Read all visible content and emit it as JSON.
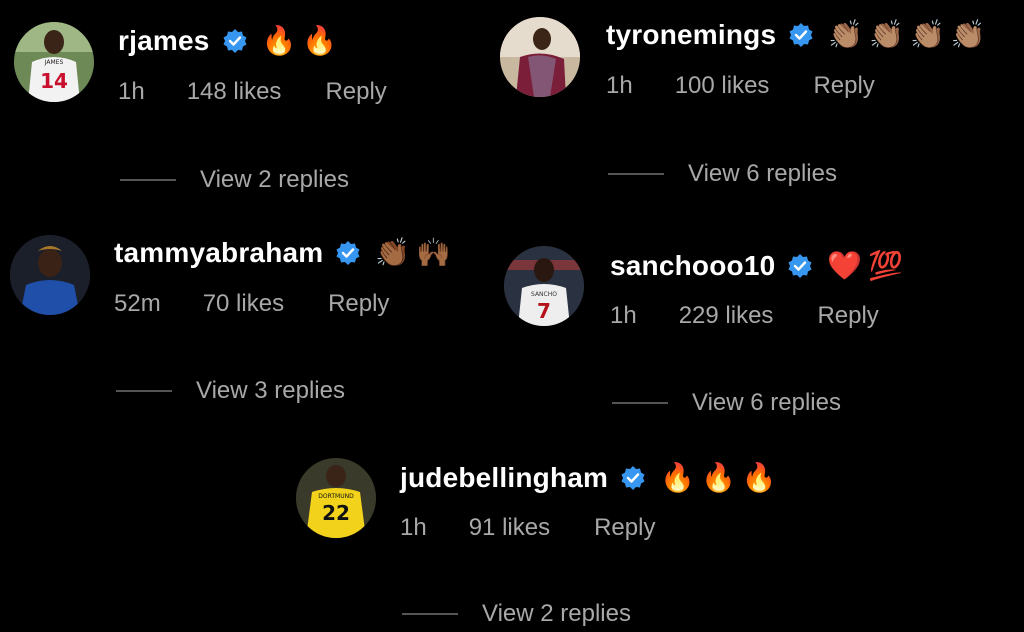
{
  "colors": {
    "background": "#000000",
    "text": "#ffffff",
    "muted": "#a8a8a8",
    "verified": "#3797f0",
    "divider": "#555555"
  },
  "comments": [
    {
      "username": "rjames",
      "emojis": "🔥🔥",
      "time": "1h",
      "likes": "148 likes",
      "reply": "Reply",
      "view_replies": "View 2 replies",
      "avatar_icon": "player-14-avatar-icon"
    },
    {
      "username": "tyronemings",
      "emojis": "👏🏽👏🏽👏🏽👏🏽",
      "time": "1h",
      "likes": "100 likes",
      "reply": "Reply",
      "view_replies": "View 6 replies",
      "avatar_icon": "player-aston-villa-avatar-icon"
    },
    {
      "username": "tammyabraham",
      "emojis": "👏🏾🙌🏾",
      "time": "52m",
      "likes": "70 likes",
      "reply": "Reply",
      "view_replies": "View 3 replies",
      "avatar_icon": "player-blue-kit-avatar-icon"
    },
    {
      "username": "sanchooo10",
      "emojis": "❤️💯",
      "time": "1h",
      "likes": "229 likes",
      "reply": "Reply",
      "view_replies": "View 6 replies",
      "avatar_icon": "player-7-avatar-icon"
    },
    {
      "username": "judebellingham",
      "emojis": "🔥🔥🔥",
      "time": "1h",
      "likes": "91 likes",
      "reply": "Reply",
      "view_replies": "View 2 replies",
      "avatar_icon": "player-22-avatar-icon"
    }
  ]
}
